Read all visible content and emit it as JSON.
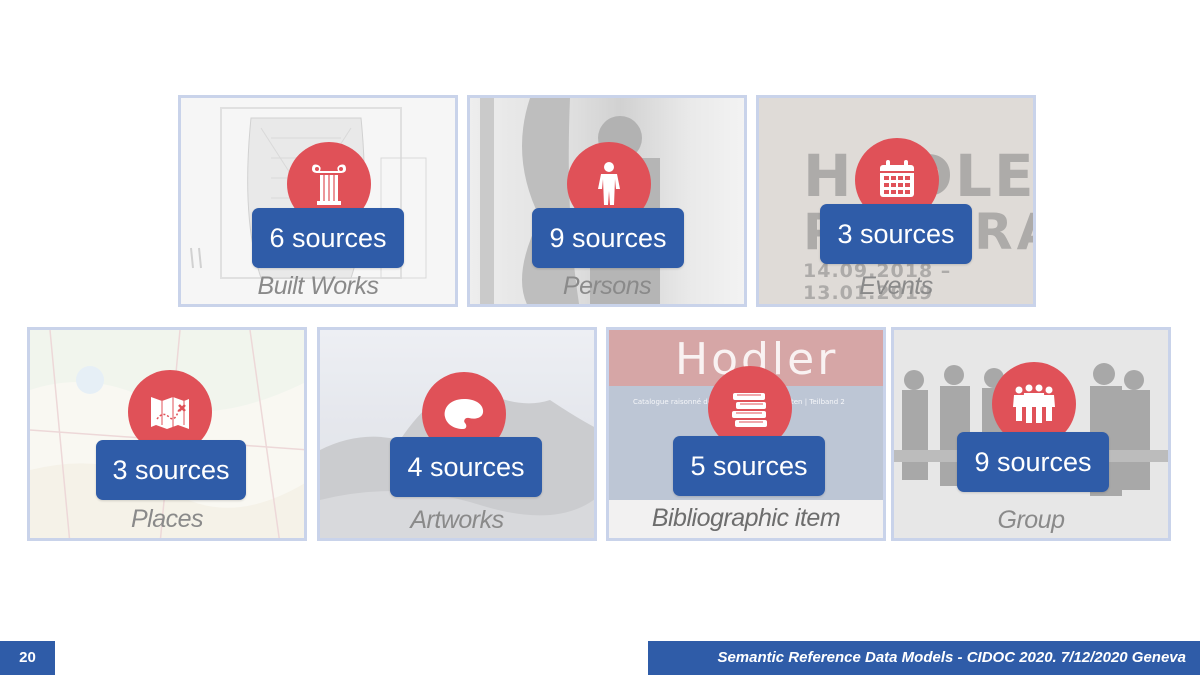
{
  "cards": [
    {
      "sources": "6 sources",
      "caption": "Built Works",
      "icon": "column-icon"
    },
    {
      "sources": "9 sources",
      "caption": "Persons",
      "icon": "person-icon"
    },
    {
      "sources": "3 sources",
      "caption": "Events",
      "icon": "calendar-icon",
      "bg_title": "HODLER",
      "bg_subtitle": "PANORAMA",
      "bg_dates": "14.09.2018 – 13.01.2019"
    },
    {
      "sources": "3 sources",
      "caption": "Places",
      "icon": "map-icon"
    },
    {
      "sources": "4 sources",
      "caption": "Artworks",
      "icon": "palette-icon"
    },
    {
      "sources": "5 sources",
      "caption": "Bibliographic item",
      "icon": "books-icon",
      "bg_title": "Hodler",
      "bg_subtitle": "Catalogue raisonné der Gemälde · Landschaften | Teilband 2"
    },
    {
      "sources": "9 sources",
      "caption": "Group",
      "icon": "group-icon"
    }
  ],
  "footer": {
    "page_number": "20",
    "text": "Semantic Reference Data Models - CIDOC 2020. 7/12/2020 Geneva"
  },
  "colors": {
    "accent_red": "#e05158",
    "accent_blue": "#2f5ca8",
    "border": "#c9d3ea"
  }
}
